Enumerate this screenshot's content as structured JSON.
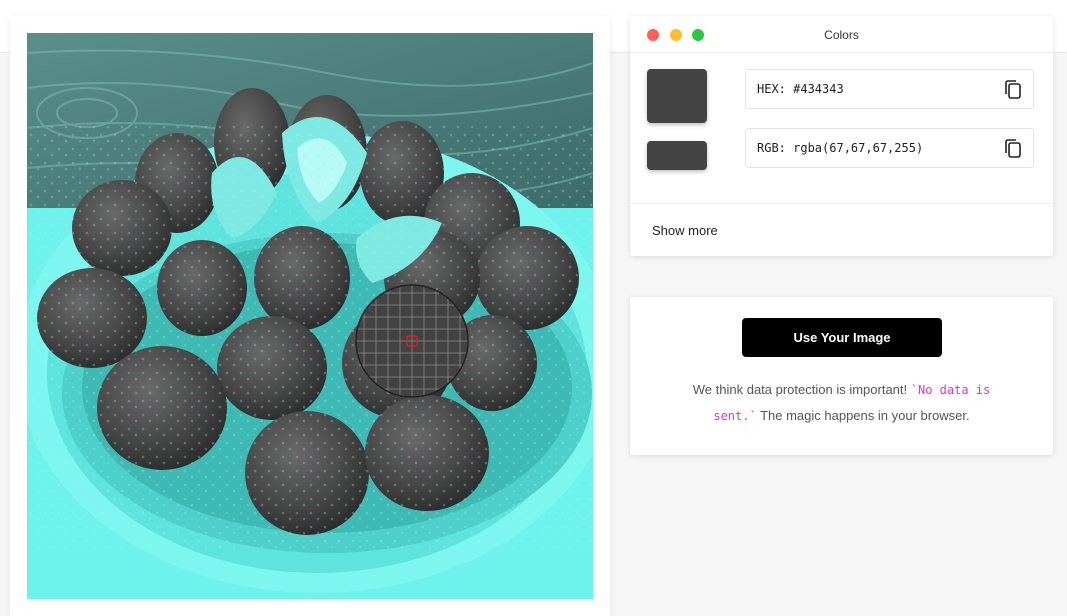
{
  "colors_panel": {
    "title": "Colors",
    "traffic_lights": {
      "close": "#fe5f57",
      "minimize": "#febc2e",
      "zoom": "#28c840"
    },
    "swatch_color": "#434343",
    "hex_text": "HEX: #434343",
    "rgb_text": "RGB: rgba(67,67,67,255)",
    "copy_icon": "copy-icon",
    "show_more_label": "Show more"
  },
  "upload_panel": {
    "button_label": "Use Your Image",
    "notice_before": "We think data protection is important! ",
    "notice_code": "`No data is sent.`",
    "notice_after": " The magic happens in your browser."
  },
  "image": {
    "tint_color": "#6ff2ec",
    "sampled_color": "#434343",
    "magnifier_icon": "magnifier-loupe"
  }
}
